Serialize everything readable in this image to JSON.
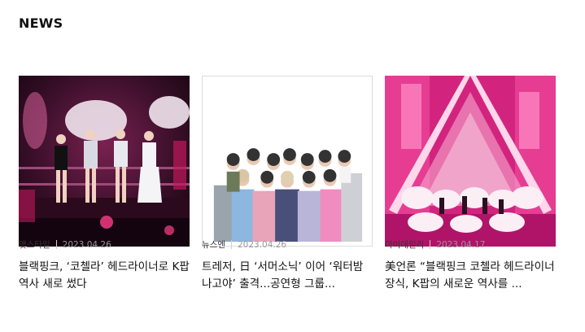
{
  "section": {
    "title": "NEWS"
  },
  "articles": [
    {
      "headline": "블랙핑크, ‘코첼라’ 헤드라이너로 K팝 역사 새로 썼다",
      "source": "앳스타일",
      "date": "2023.04.26"
    },
    {
      "headline": "트레저, 日 ‘서머소닉’ 이어 ‘워터밤 나고야’ 출격...공연형 그룹...",
      "source": "뉴스엔",
      "date": "2023.04.26"
    },
    {
      "headline": "美언론 “블랙핑크 코첼라 헤드라이너 장식, K팝의 새로운 역사를 ...",
      "source": "마이데일리",
      "date": "2023.04.17"
    }
  ]
}
